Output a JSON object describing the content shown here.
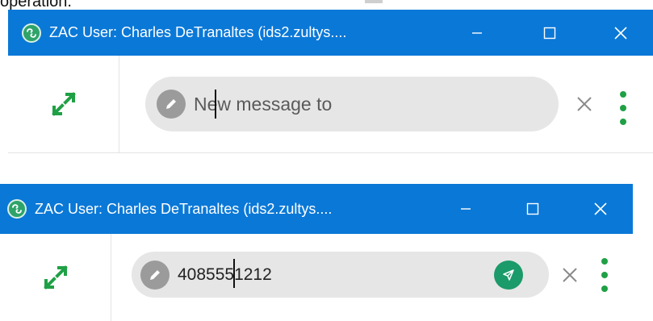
{
  "top_fragment": {
    "text": "operation."
  },
  "windows": [
    {
      "title": "ZAC User: Charles DeTranaltes (ids2.zultys....",
      "controls": {
        "minimize": "—",
        "maximize": "☐",
        "close": "✕"
      },
      "message": {
        "placeholder": "New message to",
        "value": ""
      },
      "icons": {
        "app": "zac-logo-icon",
        "expand": "expand-arrows-icon",
        "compose": "pencil-icon",
        "clear": "close-x-icon",
        "menu": "kebab-menu-icon"
      }
    },
    {
      "title": "ZAC User: Charles DeTranaltes (ids2.zultys....",
      "controls": {
        "minimize": "—",
        "maximize": "☐",
        "close": "✕"
      },
      "message": {
        "placeholder": "",
        "value": "4085551212"
      },
      "icons": {
        "app": "zac-logo-icon",
        "expand": "expand-arrows-icon",
        "compose": "pencil-icon",
        "send": "send-paper-plane-icon",
        "clear": "close-x-icon",
        "menu": "kebab-menu-icon"
      }
    }
  ],
  "colors": {
    "titlebar": "#0a78d7",
    "accent_green": "#20a045",
    "send_green": "#1b9a6a",
    "input_bg": "#e6e6e6",
    "pencil_bg": "#9b9b9b"
  }
}
